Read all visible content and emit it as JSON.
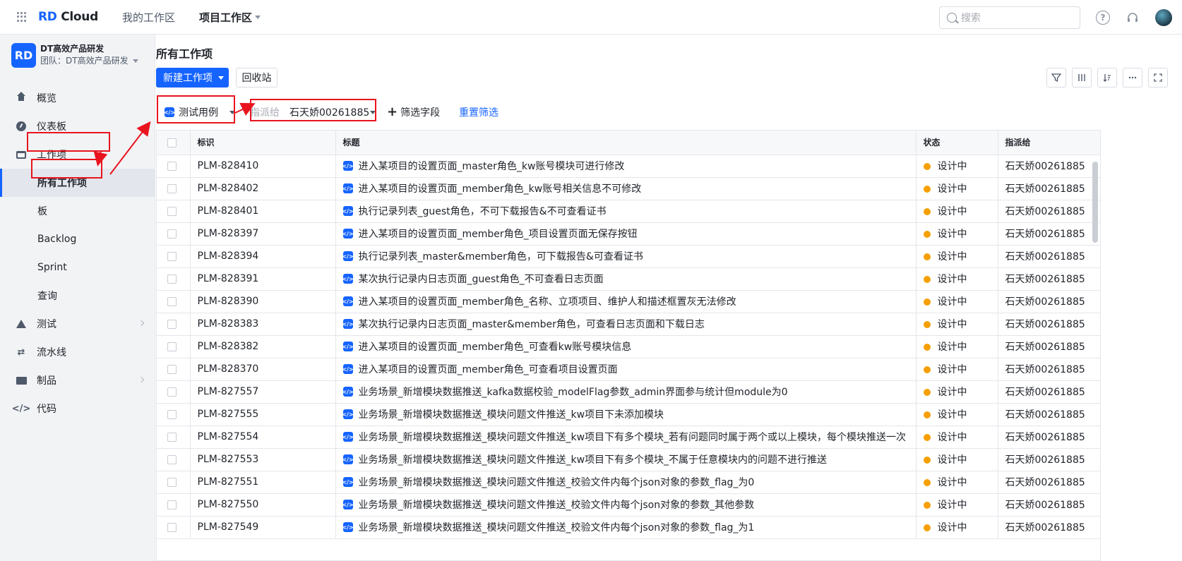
{
  "app": {
    "logo_prefix": "RD",
    "logo_suffix": " Cloud"
  },
  "top_nav": [
    {
      "label": "我的工作区"
    },
    {
      "label": "项目工作区"
    }
  ],
  "search": {
    "placeholder": "搜索"
  },
  "team": {
    "logo": "RD",
    "name": "DT高效产品研发",
    "sub": "团队：DT高效产品研发"
  },
  "sidebar": {
    "items": [
      {
        "label": "概览",
        "icon": "house-icon"
      },
      {
        "label": "仪表板",
        "icon": "gauge-icon"
      },
      {
        "label": "工作项",
        "icon": "inbox-icon"
      },
      {
        "label": "所有工作项"
      },
      {
        "label": "板"
      },
      {
        "label": "Backlog"
      },
      {
        "label": "Sprint"
      },
      {
        "label": "查询"
      },
      {
        "label": "测试",
        "icon": "flask-icon"
      },
      {
        "label": "流水线",
        "icon": "pipeline-icon"
      },
      {
        "label": "制品",
        "icon": "folder-icon"
      },
      {
        "label": "代码",
        "icon": "code-icon"
      }
    ]
  },
  "main": {
    "title": "所有工作项",
    "new_button": "新建工作项",
    "recycle_button": "回收站"
  },
  "filters": {
    "type_value": "测试用例",
    "assign_label": "指派给",
    "assign_value": "石天娇00261885",
    "add_field": "筛选字段",
    "reset": "重置筛选"
  },
  "table": {
    "headers": {
      "id": "标识",
      "title": "标题",
      "status": "状态",
      "assignee": "指派给"
    },
    "rows": [
      {
        "id": "PLM-828410",
        "title": "进入某项目的设置页面_master角色_kw账号模块可进行修改",
        "status": "设计中",
        "assignee": "石天娇00261885"
      },
      {
        "id": "PLM-828402",
        "title": "进入某项目的设置页面_member角色_kw账号相关信息不可修改",
        "status": "设计中",
        "assignee": "石天娇00261885"
      },
      {
        "id": "PLM-828401",
        "title": "执行记录列表_guest角色，不可下载报告&不可查看证书",
        "status": "设计中",
        "assignee": "石天娇00261885"
      },
      {
        "id": "PLM-828397",
        "title": "进入某项目的设置页面_member角色_项目设置页面无保存按钮",
        "status": "设计中",
        "assignee": "石天娇00261885"
      },
      {
        "id": "PLM-828394",
        "title": "执行记录列表_master&member角色，可下载报告&可查看证书",
        "status": "设计中",
        "assignee": "石天娇00261885"
      },
      {
        "id": "PLM-828391",
        "title": "某次执行记录内日志页面_guest角色_不可查看日志页面",
        "status": "设计中",
        "assignee": "石天娇00261885"
      },
      {
        "id": "PLM-828390",
        "title": "进入某项目的设置页面_member角色_名称、立项项目、维护人和描述框置灰无法修改",
        "status": "设计中",
        "assignee": "石天娇00261885"
      },
      {
        "id": "PLM-828383",
        "title": "某次执行记录内日志页面_master&member角色，可查看日志页面和下载日志",
        "status": "设计中",
        "assignee": "石天娇00261885"
      },
      {
        "id": "PLM-828382",
        "title": "进入某项目的设置页面_member角色_可查看kw账号模块信息",
        "status": "设计中",
        "assignee": "石天娇00261885"
      },
      {
        "id": "PLM-828370",
        "title": "进入某项目的设置页面_member角色_可查看项目设置页面",
        "status": "设计中",
        "assignee": "石天娇00261885"
      },
      {
        "id": "PLM-827557",
        "title": "业务场景_新增模块数据推送_kafka数据校验_modelFlag参数_admin界面参与统计但module为0",
        "status": "设计中",
        "assignee": "石天娇00261885"
      },
      {
        "id": "PLM-827555",
        "title": "业务场景_新增模块数据推送_模块问题文件推送_kw项目下未添加模块",
        "status": "设计中",
        "assignee": "石天娇00261885"
      },
      {
        "id": "PLM-827554",
        "title": "业务场景_新增模块数据推送_模块问题文件推送_kw项目下有多个模块_若有问题同时属于两个或以上模块，每个模块推送一次",
        "status": "设计中",
        "assignee": "石天娇00261885"
      },
      {
        "id": "PLM-827553",
        "title": "业务场景_新增模块数据推送_模块问题文件推送_kw项目下有多个模块_不属于任意模块内的问题不进行推送",
        "status": "设计中",
        "assignee": "石天娇00261885"
      },
      {
        "id": "PLM-827551",
        "title": "业务场景_新增模块数据推送_模块问题文件推送_校验文件内每个json对象的参数_flag_为0",
        "status": "设计中",
        "assignee": "石天娇00261885"
      },
      {
        "id": "PLM-827550",
        "title": "业务场景_新增模块数据推送_模块问题文件推送_校验文件内每个json对象的参数_其他参数",
        "status": "设计中",
        "assignee": "石天娇00261885"
      },
      {
        "id": "PLM-827549",
        "title": "业务场景_新增模块数据推送_模块问题文件推送_校验文件内每个json对象的参数_flag_为1",
        "status": "设计中",
        "assignee": "石天娇00261885"
      }
    ]
  },
  "colors": {
    "accent": "#1664ff",
    "status_designing": "#f5a000",
    "annotation": "#e8141e"
  }
}
